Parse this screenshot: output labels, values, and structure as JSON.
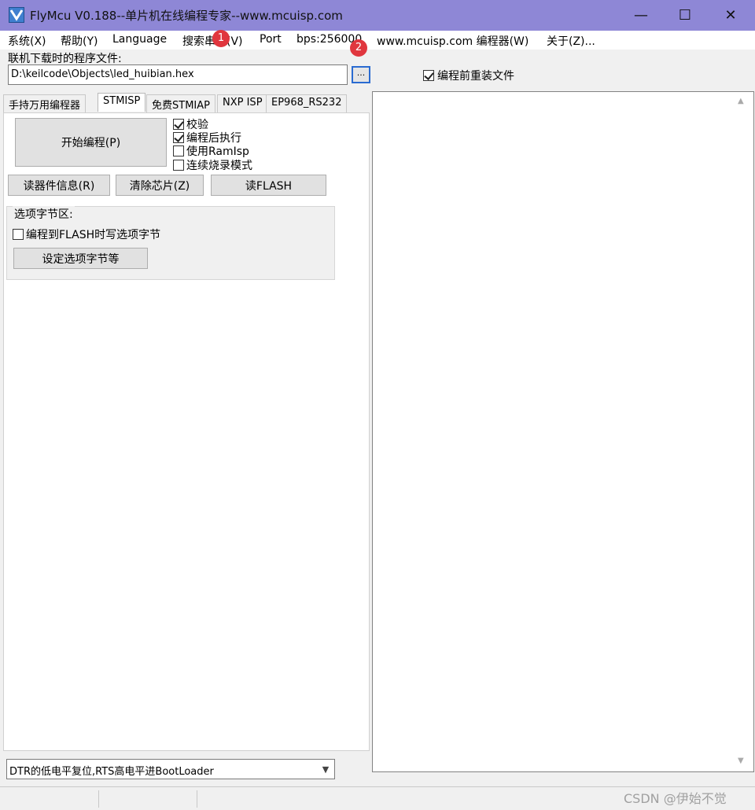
{
  "window": {
    "title": "FlyMcu V0.188--单片机在线编程专家--www.mcuisp.com",
    "minimize": "—",
    "maximize": "☐",
    "close": "✕"
  },
  "menu": {
    "items": [
      "系统(X)",
      "帮助(Y)",
      "Language",
      "搜索串口(V)",
      "Port",
      "bps:256000",
      "www.mcuisp.com 编程器(W)",
      "关于(Z)..."
    ]
  },
  "annotations": {
    "badge1": "1",
    "badge2": "2"
  },
  "file": {
    "label": "联机下载时的程序文件:",
    "path": "D:\\keilcode\\Objects\\led_huibian.hex",
    "browse": "...",
    "reload_label": "编程前重装文件",
    "reload_checked": true
  },
  "tabs": [
    "手持万用编程器",
    "STMISP",
    "免费STMIAP",
    "NXP ISP",
    "EP968_RS232"
  ],
  "stmisp": {
    "start_button": "开始编程(P)",
    "options": [
      {
        "label": "校验",
        "checked": true
      },
      {
        "label": "编程后执行",
        "checked": true
      },
      {
        "label": "使用RamIsp",
        "checked": false
      },
      {
        "label": "连续烧录模式",
        "checked": false
      }
    ],
    "read_info_button": "读器件信息(R)",
    "erase_button": "清除芯片(Z)",
    "read_flash_button": "读FLASH",
    "option_bytes": {
      "title": "选项字节区:",
      "write_label": "编程到FLASH时写选项字节",
      "write_checked": false,
      "set_button": "设定选项字节等"
    }
  },
  "reset_mode": {
    "selected": "DTR的低电平复位,RTS高电平进BootLoader"
  },
  "watermark": "CSDN @伊始不觉"
}
